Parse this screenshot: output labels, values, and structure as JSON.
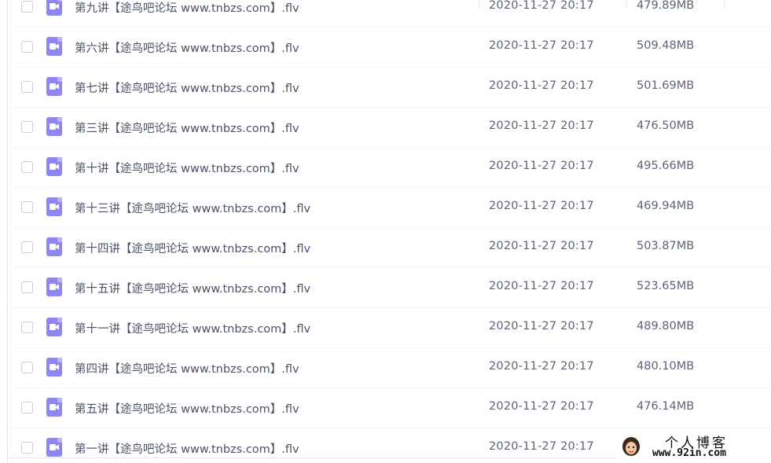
{
  "files": [
    {
      "name": "第九讲【途鸟吧论坛 www.tnbzs.com】.flv",
      "date": "2020-11-27 20:17",
      "size": "479.89MB"
    },
    {
      "name": "第六讲【途鸟吧论坛 www.tnbzs.com】.flv",
      "date": "2020-11-27 20:17",
      "size": "509.48MB"
    },
    {
      "name": "第七讲【途鸟吧论坛 www.tnbzs.com】.flv",
      "date": "2020-11-27 20:17",
      "size": "501.69MB"
    },
    {
      "name": "第三讲【途鸟吧论坛 www.tnbzs.com】.flv",
      "date": "2020-11-27 20:17",
      "size": "476.50MB"
    },
    {
      "name": "第十讲【途鸟吧论坛 www.tnbzs.com】.flv",
      "date": "2020-11-27 20:17",
      "size": "495.66MB"
    },
    {
      "name": "第十三讲【途鸟吧论坛 www.tnbzs.com】.flv",
      "date": "2020-11-27 20:17",
      "size": "469.94MB"
    },
    {
      "name": "第十四讲【途鸟吧论坛 www.tnbzs.com】.flv",
      "date": "2020-11-27 20:17",
      "size": "503.87MB"
    },
    {
      "name": "第十五讲【途鸟吧论坛 www.tnbzs.com】.flv",
      "date": "2020-11-27 20:17",
      "size": "523.65MB"
    },
    {
      "name": "第十一讲【途鸟吧论坛 www.tnbzs.com】.flv",
      "date": "2020-11-27 20:17",
      "size": "489.80MB"
    },
    {
      "name": "第四讲【途鸟吧论坛 www.tnbzs.com】.flv",
      "date": "2020-11-27 20:17",
      "size": "480.10MB"
    },
    {
      "name": "第五讲【途鸟吧论坛 www.tnbzs.com】.flv",
      "date": "2020-11-27 20:17",
      "size": "476.14MB"
    },
    {
      "name": "第一讲【途鸟吧论坛 www.tnbzs.com】.flv",
      "date": "2020-11-27 20:17",
      "size": ""
    }
  ],
  "watermark": {
    "title": "个人博客",
    "url": "www.92in.com"
  },
  "colors": {
    "file_icon": "#8e86f2",
    "text": "#4a5266",
    "checkbox_border": "#c8cdd6"
  },
  "icons": {
    "file_type": "video-file-icon",
    "checkbox": "checkbox-icon"
  }
}
